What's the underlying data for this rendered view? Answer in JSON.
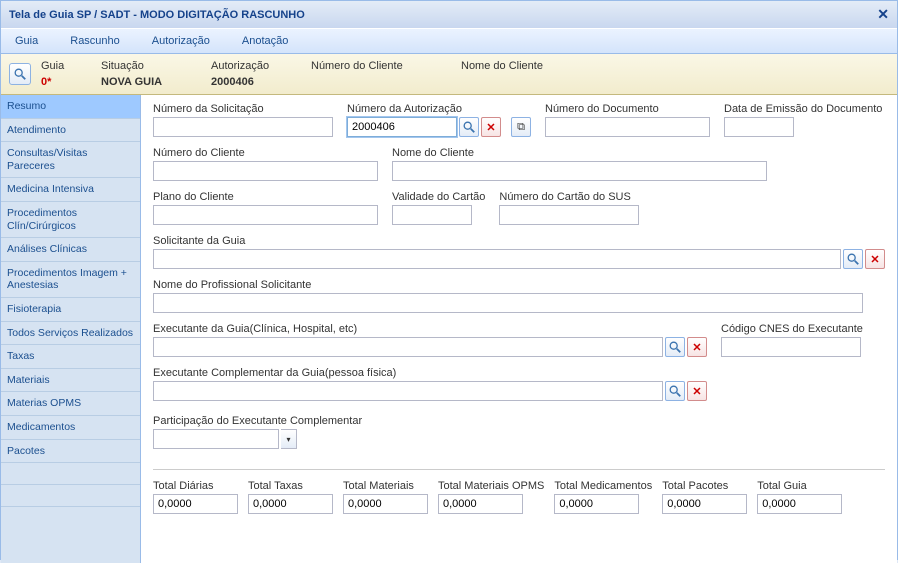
{
  "window": {
    "title": "Tela de Guia SP / SADT - MODO DIGITAÇÃO RASCUNHO"
  },
  "menubar": {
    "items": [
      "Guia",
      "Rascunho",
      "Autorização",
      "Anotação"
    ]
  },
  "context": {
    "headers": {
      "guia": "Guia",
      "situacao": "Situação",
      "autorizacao": "Autorização",
      "numCliente": "Número do Cliente",
      "nomeCliente": "Nome do Cliente"
    },
    "values": {
      "guia": "0*",
      "situacao": "NOVA GUIA",
      "autorizacao": "2000406",
      "numCliente": "",
      "nomeCliente": ""
    }
  },
  "sidebar": {
    "items": [
      {
        "label": "Resumo",
        "active": true
      },
      {
        "label": "Atendimento"
      },
      {
        "label": "Consultas/Visitas Pareceres"
      },
      {
        "label": "Medicina Intensiva"
      },
      {
        "label": "Procedimentos Clín/Cirúrgicos"
      },
      {
        "label": "Análises Clínicas"
      },
      {
        "label": "Procedimentos Imagem + Anestesias"
      },
      {
        "label": "Fisioterapia"
      },
      {
        "label": "Todos Serviços Realizados"
      },
      {
        "label": "Taxas"
      },
      {
        "label": "Materiais"
      },
      {
        "label": "Materias OPMS"
      },
      {
        "label": "Medicamentos"
      },
      {
        "label": "Pacotes"
      }
    ]
  },
  "form": {
    "numSolicitacao": {
      "label": "Número da Solicitação",
      "value": ""
    },
    "numAutorizacao": {
      "label": "Número da Autorização",
      "value": "2000406"
    },
    "numDocumento": {
      "label": "Número do Documento",
      "value": ""
    },
    "dataEmissao": {
      "label": "Data de Emissão do Documento",
      "value": ""
    },
    "numCliente": {
      "label": "Número do Cliente",
      "value": ""
    },
    "nomeCliente": {
      "label": "Nome do Cliente",
      "value": ""
    },
    "planoCliente": {
      "label": "Plano do Cliente",
      "value": ""
    },
    "validadeCartao": {
      "label": "Validade do Cartão",
      "value": ""
    },
    "numCartaoSUS": {
      "label": "Número do Cartão do SUS",
      "value": ""
    },
    "solicitanteGuia": {
      "label": "Solicitante da Guia",
      "value": ""
    },
    "nomeProfSolic": {
      "label": "Nome do Profissional Solicitante",
      "value": ""
    },
    "executanteGuia": {
      "label": "Executante da Guia(Clínica, Hospital, etc)",
      "value": ""
    },
    "cnesExecutante": {
      "label": "Código CNES do Executante",
      "value": ""
    },
    "executanteComp": {
      "label": "Executante Complementar da Guia(pessoa física)",
      "value": ""
    },
    "participExec": {
      "label": "Participação do Executante Complementar",
      "value": ""
    }
  },
  "totals": {
    "diarias": {
      "label": "Total Diárias",
      "value": "0,0000"
    },
    "taxas": {
      "label": "Total Taxas",
      "value": "0,0000"
    },
    "materiais": {
      "label": "Total Materiais",
      "value": "0,0000"
    },
    "materiaisOPMS": {
      "label": "Total Materiais OPMS",
      "value": "0,0000"
    },
    "medicamentos": {
      "label": "Total Medicamentos",
      "value": "0,0000"
    },
    "pacotes": {
      "label": "Total Pacotes",
      "value": "0,0000"
    },
    "guia": {
      "label": "Total Guia",
      "value": "0,0000"
    }
  }
}
